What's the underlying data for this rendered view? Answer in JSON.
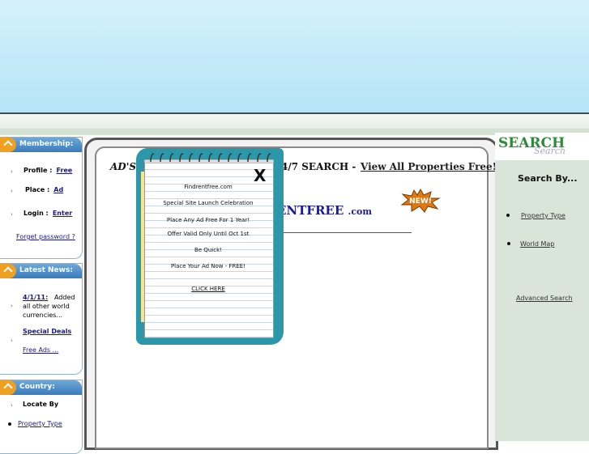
{
  "membership": {
    "title": "Membership:",
    "profile_label": "Profile :",
    "profile_link": "Free",
    "place_label": "Place :",
    "place_link": "Ad",
    "login_label": "Login :",
    "login_link": "Enter",
    "forget": "Forget password ?"
  },
  "news": {
    "title": "Latest News:",
    "date": "4/1/11:",
    "item1_line1": "Added",
    "item1_line2": "all other world",
    "item1_line3": "currencies...",
    "item2": "Special Deals",
    "item3": "Free Ads ..."
  },
  "country": {
    "title": "Country:",
    "locate": "Locate By",
    "property_type": "Property Type"
  },
  "main": {
    "headline_left": "AD'S F",
    "headline_mid": "4/7 SEARCH  -",
    "view_all": "View All Properties Free!",
    "brand": "ENTFREE",
    "brand_suffix": ".com",
    "new_badge": "NEW!"
  },
  "popup": {
    "close": "X",
    "lines": [
      "Findrentfree.com",
      "Special Site Launch Celebration",
      "Place Any Ad Free For 1 Year!",
      "Offer Valid Only Until Oct 1st",
      "Be Quick!",
      "Place Your Ad Now - FREE!",
      "CLICK HERE"
    ]
  },
  "search": {
    "logo_main": "SEARCH",
    "logo_sub": "Search",
    "title": "Search By...",
    "links": [
      "Property Type",
      "World Map"
    ],
    "advanced": "Advanced Search"
  },
  "colors": {
    "banner": "#c6ebf9",
    "sidebar_head": "#3b7bbd",
    "arrow": "#f0a020",
    "popup_frame": "#2c97a8",
    "search_green": "#2e8a3a"
  }
}
